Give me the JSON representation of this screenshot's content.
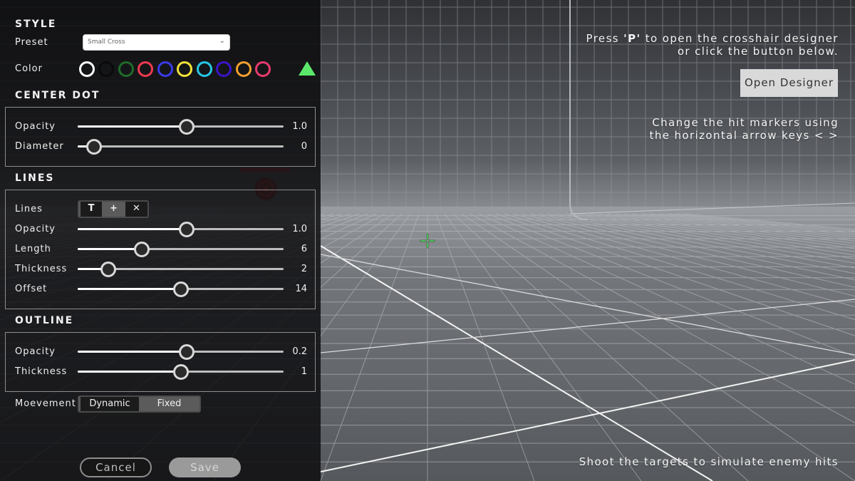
{
  "style": {
    "title": "STYLE",
    "preset_label": "Preset",
    "preset_value": "Small Cross",
    "color_label": "Color",
    "colors": [
      "#ffffff",
      "#000000",
      "#1f6b2a",
      "#ef3a4f",
      "#3a3ae8",
      "#f2e23a",
      "#26c7e6",
      "#3a14c8",
      "#f2a030",
      "#e83a6e"
    ],
    "selected_color": "#5be86a"
  },
  "center_dot": {
    "title": "CENTER DOT",
    "opacity": {
      "label": "Opacity",
      "value": "1.0",
      "fraction": 0.53
    },
    "diameter": {
      "label": "Diameter",
      "value": "0",
      "fraction": 0.08
    }
  },
  "lines": {
    "title": "LINES",
    "lines_label": "Lines",
    "line_modes": [
      "T",
      "+",
      "✕"
    ],
    "opacity": {
      "label": "Opacity",
      "value": "1.0",
      "fraction": 0.53
    },
    "length": {
      "label": "Length",
      "value": "6",
      "fraction": 0.31
    },
    "thickness": {
      "label": "Thickness",
      "value": "2",
      "fraction": 0.15
    },
    "offset": {
      "label": "Offset",
      "value": "14",
      "fraction": 0.5
    }
  },
  "outline": {
    "title": "OUTLINE",
    "opacity": {
      "label": "Opacity",
      "value": "0.2",
      "fraction": 0.53
    },
    "thickness": {
      "label": "Thickness",
      "value": "1",
      "fraction": 0.5
    }
  },
  "movement": {
    "label": "Moevement",
    "options": [
      "Dynamic",
      "Fixed"
    ],
    "selected": "Dynamic"
  },
  "buttons": {
    "cancel": "Cancel",
    "save": "Save"
  },
  "hints": {
    "designer_prefix": "Press ",
    "designer_key": "'P'",
    "designer_suffix": " to open the crosshair designer",
    "designer_line2": "or click the button below.",
    "open_designer": "Open Designer",
    "hitmarkers_line1": "Change the hit markers using",
    "hitmarkers_line2": "the horizontal arrow keys < >",
    "shoot": "Shoot the targets to simulate enemy hits"
  },
  "colors": {
    "panel_bg": "#0c0c0e",
    "crosshair": "#5be86a",
    "target": "#d03030"
  },
  "icons": [
    "chevron-down-icon",
    "triangle-icon",
    "crosshair-icon",
    "target-icon"
  ]
}
